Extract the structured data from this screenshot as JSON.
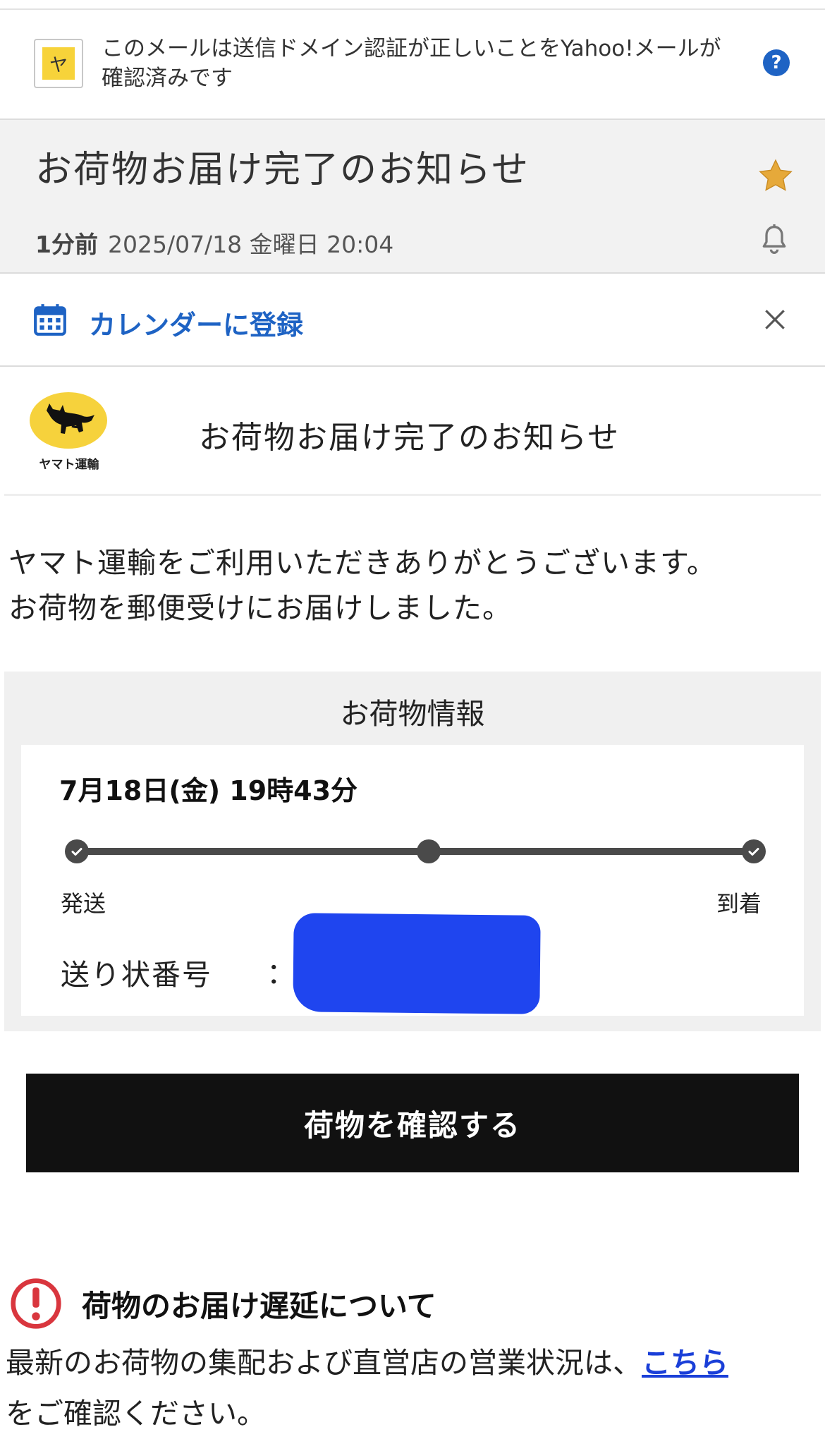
{
  "verification": {
    "badge": "ヤ",
    "text": "このメールは送信ドメイン認証が正しいことをYahoo!メールが確認済みです",
    "help": "?"
  },
  "header": {
    "subject": "お荷物お届け完了のお知らせ",
    "relative_time": "1分前",
    "datetime": "2025/07/18 金曜日 20:04",
    "starred": true
  },
  "calendar": {
    "label": "カレンダーに登録"
  },
  "mail": {
    "logo_caption": "ヤマト運輸",
    "heading": "お荷物お届け完了のお知らせ",
    "intro_line1": "ヤマト運輸をご利用いただきありがとうございます。",
    "intro_line2": "お荷物を郵便受けにお届けしました。",
    "package": {
      "title": "お荷物情報",
      "date": "7月18日(金) 19時43分",
      "progress": {
        "start_label": "発送",
        "end_label": "到着",
        "steps": 3,
        "completed": 3
      },
      "invoice_label": "送り状番号",
      "invoice_colon": "："
    },
    "button_label": "荷物を確認する",
    "notice": {
      "title": "荷物のお届け遅延について",
      "text_before": "最新のお荷物の集配および直営店の営業状況は、",
      "link": "こちら",
      "text_after": "をご確認ください。"
    }
  },
  "colors": {
    "accent": "#1e63c4",
    "logo_yellow": "#f6d23c",
    "star": "#e6a93a",
    "alert_red": "#d9363e",
    "redaction": "#1f45ef"
  }
}
